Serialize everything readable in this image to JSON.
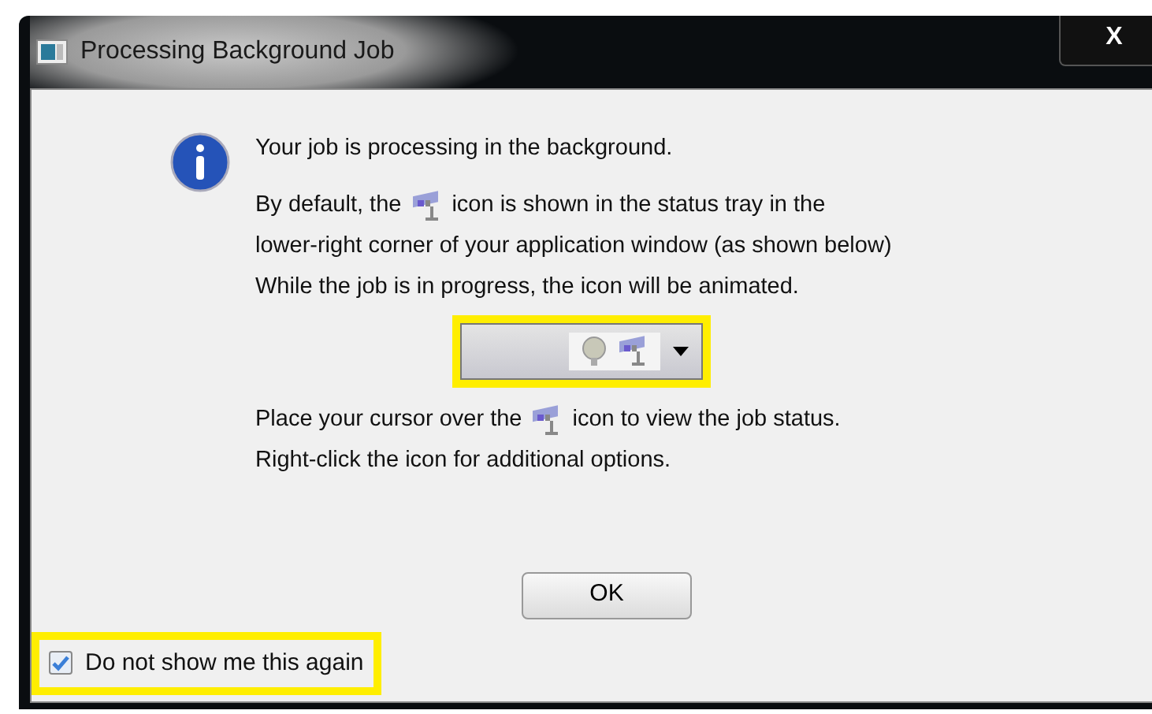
{
  "window": {
    "title": "Processing Background Job",
    "close_label": "X"
  },
  "message": {
    "heading": "Your job is processing in the background.",
    "paragraph_1": [
      [
        {
          "kind": "text",
          "text": "By default, the"
        },
        {
          "kind": "icon"
        },
        {
          "kind": "text",
          "text": "icon is shown in the status tray in the"
        }
      ],
      [
        {
          "kind": "text",
          "text": "lower-right corner of your application window (as shown below)"
        }
      ],
      [
        {
          "kind": "text",
          "text": "While the job is in progress, the icon will be animated."
        }
      ]
    ],
    "tray_preview": {
      "highlighted": true
    },
    "paragraph_2": [
      [
        {
          "kind": "text",
          "text": "Place your cursor over the"
        },
        {
          "kind": "icon"
        },
        {
          "kind": "text",
          "text": "icon to view the job status."
        }
      ],
      [
        {
          "kind": "text",
          "text": "Right-click the icon for additional options."
        }
      ]
    ]
  },
  "buttons": [
    "OK"
  ],
  "checkbox": {
    "label": "Do not show me this again",
    "checked": true,
    "highlighted": true
  }
}
